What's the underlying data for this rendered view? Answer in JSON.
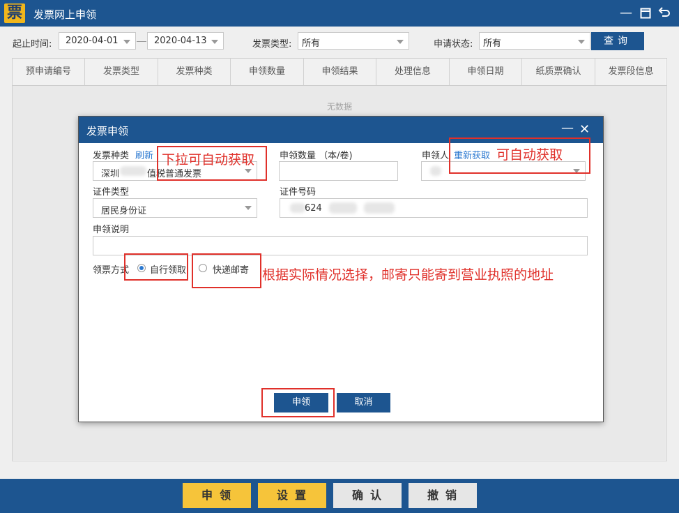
{
  "app": {
    "icon_char": "票",
    "title": "发票网上申领"
  },
  "filters": {
    "date_label": "起止时间:",
    "date_start": "2020-04-01",
    "date_end": "2020-04-13",
    "type_label": "发票类型:",
    "type_value": "所有",
    "status_label": "申请状态:",
    "status_value": "所有",
    "query_label": "查询"
  },
  "table": {
    "columns": [
      "预申请编号",
      "发票类型",
      "发票种类",
      "申领数量",
      "申领结果",
      "处理信息",
      "申领日期",
      "纸质票确认",
      "发票段信息"
    ],
    "empty_text": "无数据"
  },
  "dialog": {
    "title": "发票申领",
    "invoice_kind_label": "发票种类",
    "refresh_link": "刷新",
    "invoice_kind_value_a": "深圳",
    "invoice_kind_value_b": "值税普通发票",
    "quantity_label": "申领数量 （本/卷)",
    "quantity_value": "",
    "applicant_label": "申领人",
    "reacquire_link": "重新获取",
    "cert_type_label": "证件类型",
    "cert_type_value": "居民身份证",
    "cert_no_label": "证件号码",
    "cert_no_value": "624",
    "note_label": "申领说明",
    "note_value": "",
    "method_label": "领票方式",
    "method_options": [
      "自行领取",
      "快递邮寄"
    ],
    "method_selected": "自行领取",
    "submit_label": "申领",
    "cancel_label": "取消"
  },
  "annotations": {
    "dropdown_auto": "下拉可自动获取",
    "auto_get": "可自动获取",
    "choose_note": "根据实际情况选择，邮寄只能寄到营业执照的地址"
  },
  "bottom_buttons": [
    "申领",
    "设置",
    "确认",
    "撤销"
  ],
  "colors": {
    "primary": "#1d5590",
    "accent_yellow": "#f6c43a",
    "annotation_red": "#e0302a",
    "link_blue": "#2a78d0"
  }
}
